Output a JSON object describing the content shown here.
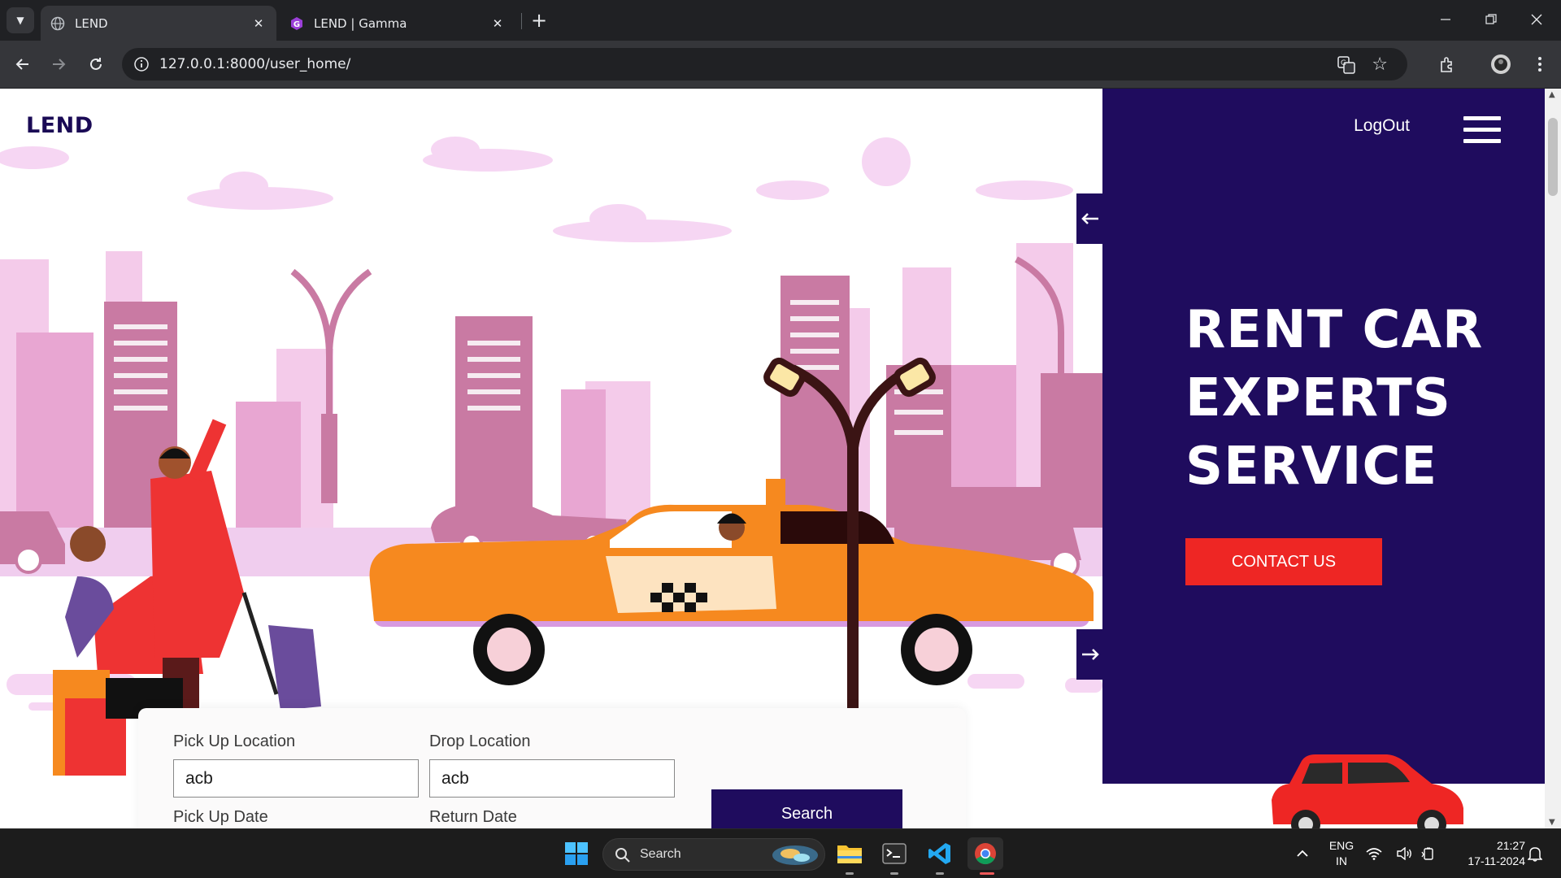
{
  "browser": {
    "tabs": [
      {
        "title": "LEND",
        "active": true
      },
      {
        "title": "LEND | Gamma",
        "active": false
      }
    ],
    "url": "127.0.0.1:8000/user_home/"
  },
  "page": {
    "logo": "LEND",
    "nav": {
      "logout_label": "LogOut"
    },
    "hero": {
      "title_lines": [
        "RENT CAR",
        "EXPERTS",
        "SERVICE"
      ],
      "contact_label": "CONTACT US"
    },
    "booking": {
      "pickup_location_label": "Pick Up Location",
      "pickup_location_value": "acb",
      "drop_location_label": "Drop Location",
      "drop_location_value": "acb",
      "pickup_date_label": "Pick Up Date",
      "return_date_label": "Return Date",
      "search_label": "Search"
    },
    "colors": {
      "brand_navy": "#1f0c5e",
      "accent_red": "#ee2624",
      "taxi_orange": "#f6891f"
    }
  },
  "taskbar": {
    "search_label": "Search",
    "lang_line1": "ENG",
    "lang_line2": "IN",
    "time": "21:27",
    "date": "17-11-2024"
  }
}
